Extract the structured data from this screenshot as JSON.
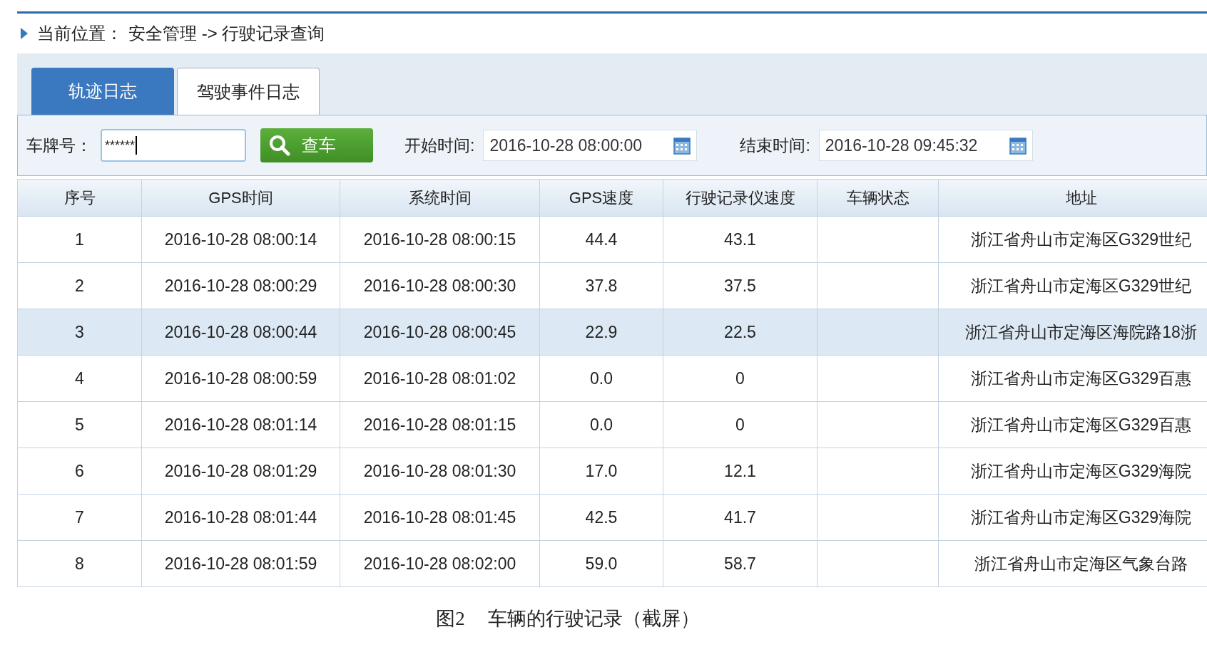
{
  "breadcrumb": {
    "label": "当前位置：",
    "path": "安全管理 -> 行驶记录查询"
  },
  "tabs": [
    {
      "label": "轨迹日志",
      "selected": true
    },
    {
      "label": "驾驶事件日志",
      "selected": false
    }
  ],
  "filters": {
    "plate_label": "车牌号：",
    "plate_value": "******",
    "search_button": "查车",
    "start_label": "开始时间:",
    "start_value": "2016-10-28 08:00:00",
    "end_label": "结束时间:",
    "end_value": "2016-10-28 09:45:32"
  },
  "table": {
    "columns": [
      "序号",
      "GPS时间",
      "系统时间",
      "GPS速度",
      "行驶记录仪速度",
      "车辆状态",
      "地址"
    ],
    "rows": [
      {
        "cells": [
          "1",
          "2016-10-28 08:00:14",
          "2016-10-28 08:00:15",
          "44.4",
          "43.1",
          "",
          "浙江省舟山市定海区G329世纪"
        ],
        "selected": false
      },
      {
        "cells": [
          "2",
          "2016-10-28 08:00:29",
          "2016-10-28 08:00:30",
          "37.8",
          "37.5",
          "",
          "浙江省舟山市定海区G329世纪"
        ],
        "selected": false
      },
      {
        "cells": [
          "3",
          "2016-10-28 08:00:44",
          "2016-10-28 08:00:45",
          "22.9",
          "22.5",
          "",
          "浙江省舟山市定海区海院路18浙"
        ],
        "selected": true
      },
      {
        "cells": [
          "4",
          "2016-10-28 08:00:59",
          "2016-10-28 08:01:02",
          "0.0",
          "0",
          "",
          "浙江省舟山市定海区G329百惠"
        ],
        "selected": false
      },
      {
        "cells": [
          "5",
          "2016-10-28 08:01:14",
          "2016-10-28 08:01:15",
          "0.0",
          "0",
          "",
          "浙江省舟山市定海区G329百惠"
        ],
        "selected": false
      },
      {
        "cells": [
          "6",
          "2016-10-28 08:01:29",
          "2016-10-28 08:01:30",
          "17.0",
          "12.1",
          "",
          "浙江省舟山市定海区G329海院"
        ],
        "selected": false
      },
      {
        "cells": [
          "7",
          "2016-10-28 08:01:44",
          "2016-10-28 08:01:45",
          "42.5",
          "41.7",
          "",
          "浙江省舟山市定海区G329海院"
        ],
        "selected": false
      },
      {
        "cells": [
          "8",
          "2016-10-28 08:01:59",
          "2016-10-28 08:02:00",
          "59.0",
          "58.7",
          "",
          "浙江省舟山市定海区气象台路"
        ],
        "selected": false
      }
    ]
  },
  "caption": {
    "figure": "图2",
    "text": "车辆的行驶记录（截屏）"
  }
}
